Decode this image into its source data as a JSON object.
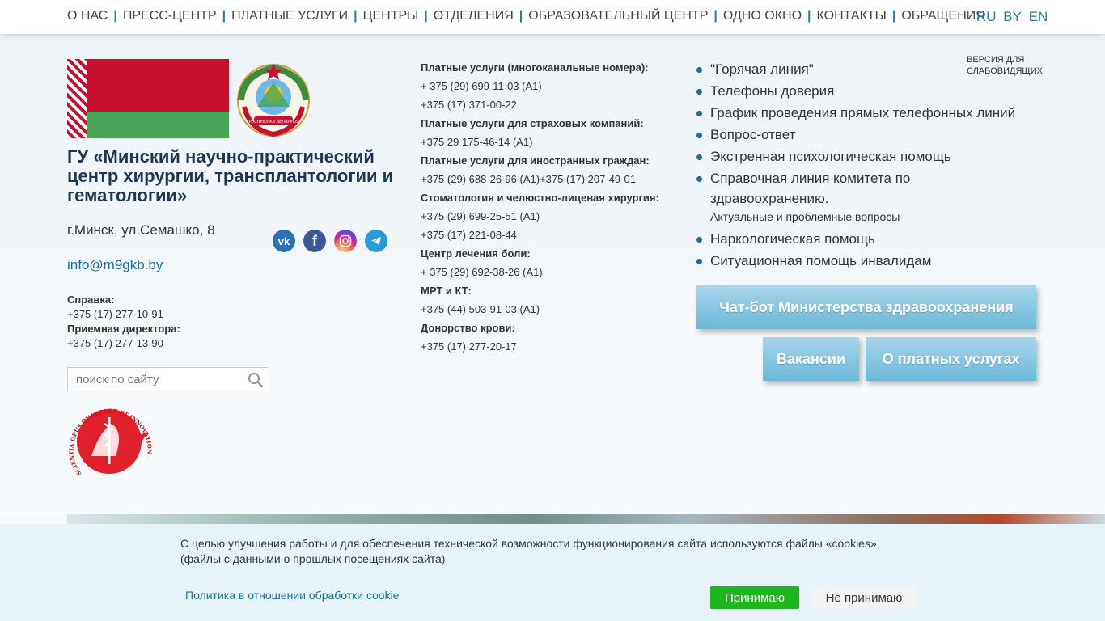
{
  "nav": {
    "items": [
      "О НАС",
      "ПРЕСС-ЦЕНТР",
      "ПЛАТНЫЕ УСЛУГИ",
      "ЦЕНТРЫ",
      "ОТДЕЛЕНИЯ",
      "ОБРАЗОВАТЕЛЬНЫЙ ЦЕНТР",
      "ОДНО ОКНО",
      "КОНТАКТЫ",
      "ОБРАЩЕНИЯ"
    ],
    "langs": [
      "RU",
      "BY",
      "EN"
    ]
  },
  "org": {
    "title": "ГУ «Минский научно-практический центр хирургии, трансплантологии и гематологии»",
    "address": "г.Минск, ул.Семашко, 8",
    "email": "info@m9gkb.by",
    "reference_label": "Справка:",
    "reference_phone": "+375 (17) 277-10-91",
    "reception_label": "Приемная директора:",
    "reception_phone": "+375 (17) 277-13-90"
  },
  "social": [
    "vk-icon",
    "facebook-icon",
    "instagram-icon",
    "telegram-icon"
  ],
  "search": {
    "placeholder": "поиск по сайту"
  },
  "emblem_text": "РЭСПУБЛІКА БЕЛАРУСЬ",
  "badge_text": "SCIENTIA OPUS QUAERERE ET INNOVATION",
  "phones": [
    {
      "heading": "Платные услуги (многоканальные номера):",
      "lines": [
        "+ 375 (29) 699-11-03 (А1)",
        "+375 (17) 371-00-22"
      ]
    },
    {
      "heading": "Платные услуги для страховых компаний:",
      "lines": [
        "+375 29 175-46-14 (А1)"
      ]
    },
    {
      "heading": "Платные услуги для иностранных граждан:",
      "lines": [
        "+375 (29) 688-26-96 (А1)+375 (17) 207-49-01"
      ]
    },
    {
      "heading": "Стоматология и челюстно-лицевая хирургия:",
      "lines": [
        "+375 (29) 699-25-51 (А1)",
        "+375 (17) 221-08-44"
      ]
    },
    {
      "heading": "Центр лечения боли:",
      "lines": [
        "+ 375 (29) 692-38-26 (А1)"
      ]
    },
    {
      "heading": "МРТ и КТ:",
      "lines": [
        "+375 (44) 503-91-03 (А1)"
      ]
    },
    {
      "heading": "Донорство крови:",
      "lines": [
        "+375 (17) 277-20-17"
      ]
    }
  ],
  "links": {
    "items": [
      "\"Горячая линия\"",
      "Телефоны доверия",
      "График проведения прямых телефонных линий",
      "Вопрос-ответ",
      "Экстренная психологическая помощь",
      "Справочная линия комитета по здравоохранению.",
      "Наркологическая помощь",
      "Ситуационная помощь инвалидам"
    ],
    "sub_note": "Актуальные и проблемные вопросы"
  },
  "low_vision": "ВЕРСИЯ ДЛЯ СЛАБОВИДЯЩИХ",
  "buttons": {
    "chat_bot": "Чат-бот Министерства здравоохранения",
    "vacancies": "Вакансии",
    "paid_services": "О платных услугах"
  },
  "cookie": {
    "message": "С целью улучшения работы и для обеспечения технической возможности функционирования сайта используются файлы «cookies» (файлы с данными о прошлых посещениях сайта)",
    "policy_link": "Политика в отношении обработки cookie",
    "accept": "Принимаю",
    "decline": "Не принимаю"
  }
}
